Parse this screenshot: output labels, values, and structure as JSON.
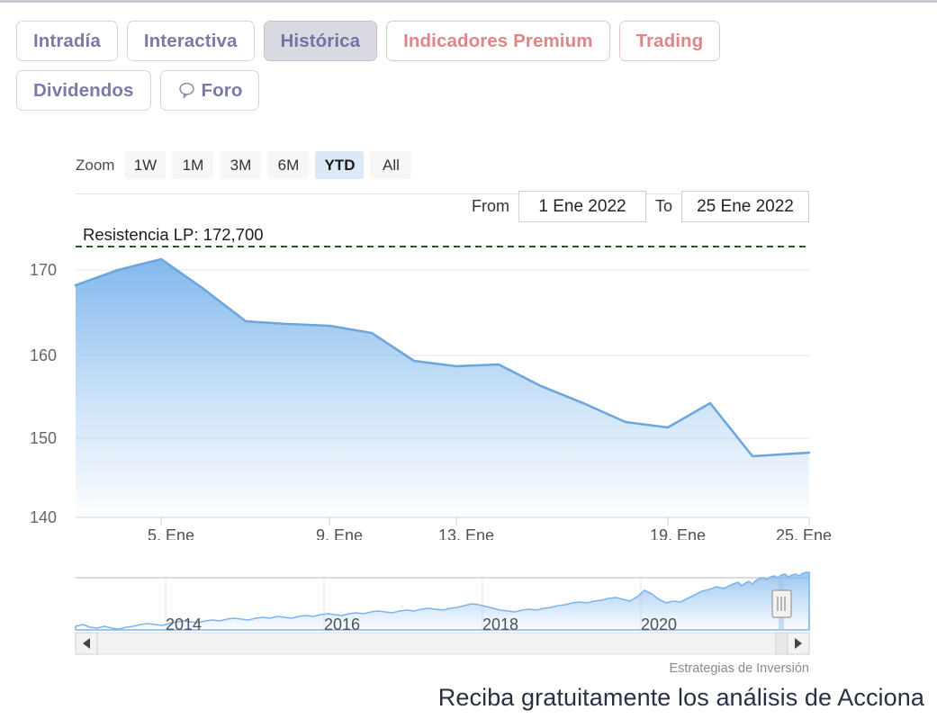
{
  "tabs": {
    "row1": [
      {
        "label": "Intradía",
        "state": "default",
        "icon": null
      },
      {
        "label": "Interactiva",
        "state": "default",
        "icon": null
      },
      {
        "label": "Histórica",
        "state": "active",
        "icon": null
      },
      {
        "label": "Indicadores Premium",
        "state": "premium",
        "icon": null
      },
      {
        "label": "Trading",
        "state": "premium",
        "icon": null
      }
    ],
    "row2": [
      {
        "label": "Dividendos",
        "state": "default",
        "icon": null
      },
      {
        "label": "Foro",
        "state": "default",
        "icon": "speech-bubble-icon"
      }
    ]
  },
  "rangeselector": {
    "zoom_label": "Zoom",
    "buttons": [
      {
        "label": "1W",
        "selected": false
      },
      {
        "label": "1M",
        "selected": false
      },
      {
        "label": "3M",
        "selected": false
      },
      {
        "label": "6M",
        "selected": false
      },
      {
        "label": "YTD",
        "selected": true
      },
      {
        "label": "All",
        "selected": false
      }
    ],
    "from_label": "From",
    "from_value": "1 Ene 2022",
    "to_label": "To",
    "to_value": "25 Ene 2022"
  },
  "credit": "Estrategias de Inversión",
  "headline": "Reciba gratuitamente los análisis de Acciona",
  "colors": {
    "line": "#7cb5ec",
    "area_top": "#7cb5ec",
    "area_bottom": "#ffffff",
    "resistance": "#1b5e20",
    "accent_purple": "#7a7aa6",
    "accent_premium": "#df8585",
    "selected_range": "#dbe8f6",
    "gridline": "#e6e6e6"
  },
  "chart_data": {
    "type": "area",
    "title": "",
    "xlabel": "",
    "ylabel": "",
    "ylim": [
      138,
      173.5
    ],
    "yticks": [
      140,
      150,
      160,
      170
    ],
    "xticks": [
      "5. Ene",
      "9. Ene",
      "13. Ene",
      "19. Ene",
      "25. Ene"
    ],
    "grid": true,
    "legend": false,
    "annotations": [
      {
        "label": "Resistencia LP: 172,700",
        "value": 172.7,
        "type": "hline",
        "color": "#1b5e20",
        "style": "dashed"
      }
    ],
    "x": [
      "3. Ene",
      "4. Ene",
      "5. Ene",
      "6. Ene",
      "7. Ene",
      "10. Ene",
      "11. Ene",
      "12. Ene",
      "13. Ene",
      "14. Ene",
      "17. Ene",
      "18. Ene",
      "19. Ene",
      "20. Ene",
      "21. Ene",
      "24. Ene",
      "25. Ene"
    ],
    "series": [
      {
        "name": "Acciona",
        "values": [
          168.3,
          170.2,
          171.4,
          167.9,
          164.0,
          163.7,
          163.5,
          162.6,
          159.3,
          158.7,
          158.9,
          156.3,
          154.2,
          152.0,
          151.4,
          154.3,
          148.0
        ]
      }
    ],
    "navigator": {
      "type": "area",
      "xticks": [
        "2014",
        "2016",
        "2018",
        "2020"
      ],
      "range_selected_end": 0.985,
      "values": [
        129.5,
        128.8,
        128.2,
        129.2,
        130.4,
        129.6,
        128.7,
        127.6,
        128.0,
        129.4,
        130.9,
        132.0,
        131.4,
        130.6,
        131.5,
        133.2,
        134.6,
        135.9,
        137.1,
        136.2,
        135.4,
        136.8,
        138.4,
        139.9,
        141.2,
        140.4,
        139.6,
        140.8,
        142.3,
        143.6,
        142.8,
        141.9,
        142.7,
        144.2,
        145.8,
        147.1,
        146.2,
        145.4,
        146.6,
        148.0,
        149.4,
        148.6,
        147.8,
        149.0,
        150.4,
        151.8,
        150.9,
        150.1,
        151.3,
        152.7,
        154.1,
        153.2,
        152.4,
        153.6,
        155.0,
        156.4,
        155.5,
        154.7,
        155.9,
        157.3,
        158.7,
        157.8,
        157.0,
        158.2,
        159.6,
        161.0,
        160.1,
        159.3,
        160.5,
        161.9,
        163.3,
        162.4,
        161.6,
        162.8,
        164.2,
        165.6,
        164.7,
        163.9,
        165.1,
        166.5,
        167.9,
        167.0,
        166.2,
        167.4,
        168.8,
        170.2,
        169.3,
        168.5,
        169.7,
        171.1,
        172.5,
        171.6,
        170.8,
        172.0,
        173.4,
        174.8,
        173.9,
        173.1,
        174.3,
        175.7
      ]
    }
  }
}
